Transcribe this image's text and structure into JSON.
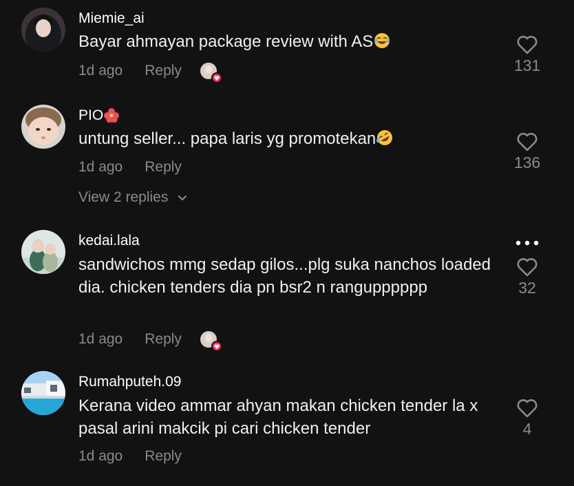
{
  "comments": [
    {
      "username": "Miemie_ai",
      "text": "Bayar ahmayan package review with AS",
      "emoji": "joy-face",
      "time": "1d ago",
      "reply": "Reply",
      "likes": "131",
      "liked_by_creator": true
    },
    {
      "username": "PIO",
      "username_emoji": "hibiscus",
      "text": "untung seller... papa laris yg promotekan",
      "emoji": "rofl-face",
      "time": "1d ago",
      "reply": "Reply",
      "likes": "136",
      "view_replies": "View 2 replies",
      "liked_by_creator": false
    },
    {
      "username": "kedai.lala",
      "text": "sandwichos mmg sedap gilos...plg suka nanchos loaded dia. chicken tenders dia pn bsr2 n rangupppppp",
      "time": "1d ago",
      "reply": "Reply",
      "likes": "32",
      "liked_by_creator": true
    },
    {
      "username": "Rumahputeh.09",
      "text": "Kerana video ammar ahyan makan chicken tender la x pasal arini makcik pi cari chicken tender",
      "time": "1d ago",
      "reply": "Reply",
      "likes": "4",
      "liked_by_creator": false
    }
  ],
  "colors": {
    "background": "#121212",
    "primary_text": "#ffffff",
    "secondary_text": "#8a8a8a",
    "heart_badge": "#fe2c55"
  }
}
